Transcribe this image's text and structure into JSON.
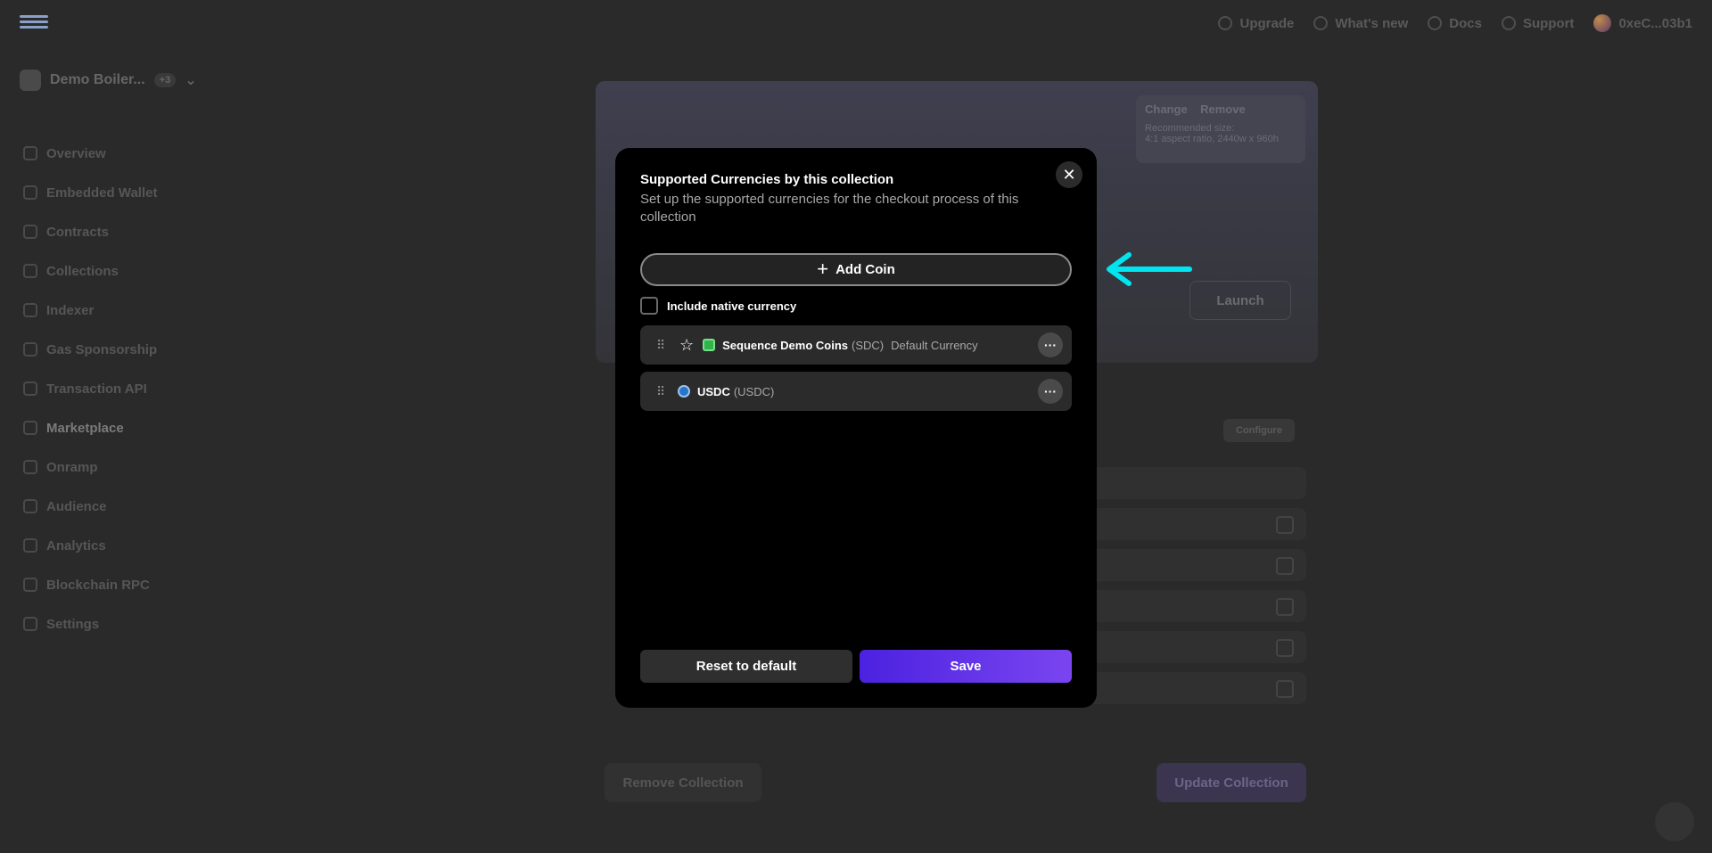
{
  "topbar": {
    "upgrade": "Upgrade",
    "whats_new": "What's new",
    "docs": "Docs",
    "support": "Support",
    "account": "0xeC...03b1"
  },
  "project": {
    "name": "Demo Boiler...",
    "badge": "+3"
  },
  "sidebar": {
    "items": [
      {
        "label": "Overview",
        "icon": "home-icon"
      },
      {
        "label": "Embedded Wallet",
        "icon": "wallet-icon"
      },
      {
        "label": "Contracts",
        "icon": "contract-icon"
      },
      {
        "label": "Collections",
        "icon": "layers-icon"
      },
      {
        "label": "Indexer",
        "icon": "grid-icon"
      },
      {
        "label": "Gas Sponsorship",
        "icon": "gas-icon"
      },
      {
        "label": "Transaction API",
        "icon": "api-icon"
      },
      {
        "label": "Marketplace",
        "icon": "store-icon"
      },
      {
        "label": "Onramp",
        "icon": "onramp-icon"
      },
      {
        "label": "Audience",
        "icon": "audience-icon"
      },
      {
        "label": "Analytics",
        "icon": "chart-icon"
      },
      {
        "label": "Blockchain RPC",
        "icon": "rpc-icon"
      },
      {
        "label": "Settings",
        "icon": "gear-icon"
      }
    ]
  },
  "background": {
    "banner_change": "Change",
    "banner_remove": "Remove",
    "banner_hint_line1": "Recommended size:",
    "banner_hint_line2": "4:1 aspect ratio, 2440w x 960h",
    "launch": "Launch",
    "configure": "Configure",
    "remove_collection": "Remove Collection",
    "update_collection": "Update Collection"
  },
  "modal": {
    "title": "Supported Currencies by this collection",
    "subtitle": "Set up the supported currencies for the checkout process of this collection",
    "add_coin": "Add Coin",
    "include_native": "Include native currency",
    "coins": [
      {
        "name": "Sequence Demo Coins",
        "symbol": "(SDC)",
        "default_label": "Default Currency"
      },
      {
        "name": "USDC",
        "symbol": "(USDC)"
      }
    ],
    "reset": "Reset to default",
    "save": "Save"
  },
  "colors": {
    "accent": "#5b2ee6",
    "arrow": "#00e5f0"
  }
}
